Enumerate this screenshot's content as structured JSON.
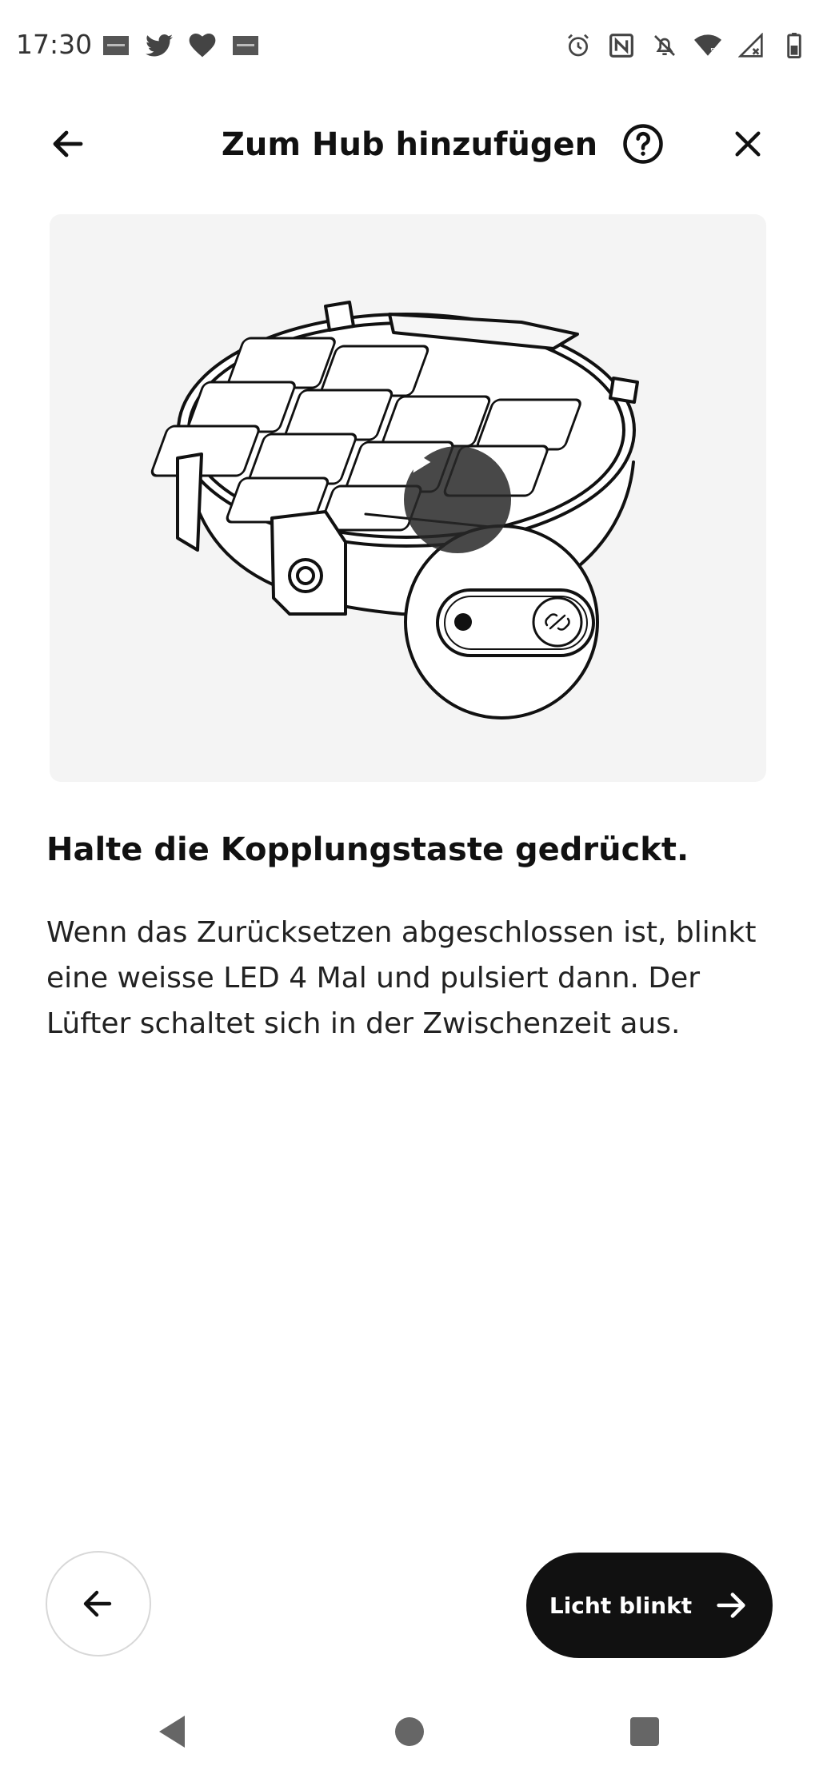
{
  "status_bar": {
    "time": "17:30",
    "left_icons": [
      "sonos-app-icon",
      "twitter-icon",
      "heart-icon",
      "sonos-app-icon"
    ],
    "right_icons": [
      "alarm-icon",
      "nfc-icon",
      "bell-off-icon",
      "wifi-icon",
      "signal-icon",
      "battery-icon"
    ],
    "wifi_label": "5"
  },
  "header": {
    "title": "Zum Hub hinzufügen"
  },
  "step": {
    "heading": "Halte die Kopplungstaste gedrückt.",
    "body": "Wenn das Zurücksetzen abgeschlossen ist, blinkt eine weisse LED 4 Mal und pulsiert dann. Der Lüfter schaltet sich in der Zwischenzeit aus."
  },
  "actions": {
    "next_label": "Licht blinkt"
  },
  "colors": {
    "primary_button": "#111111",
    "card_background": "#f4f4f4"
  }
}
